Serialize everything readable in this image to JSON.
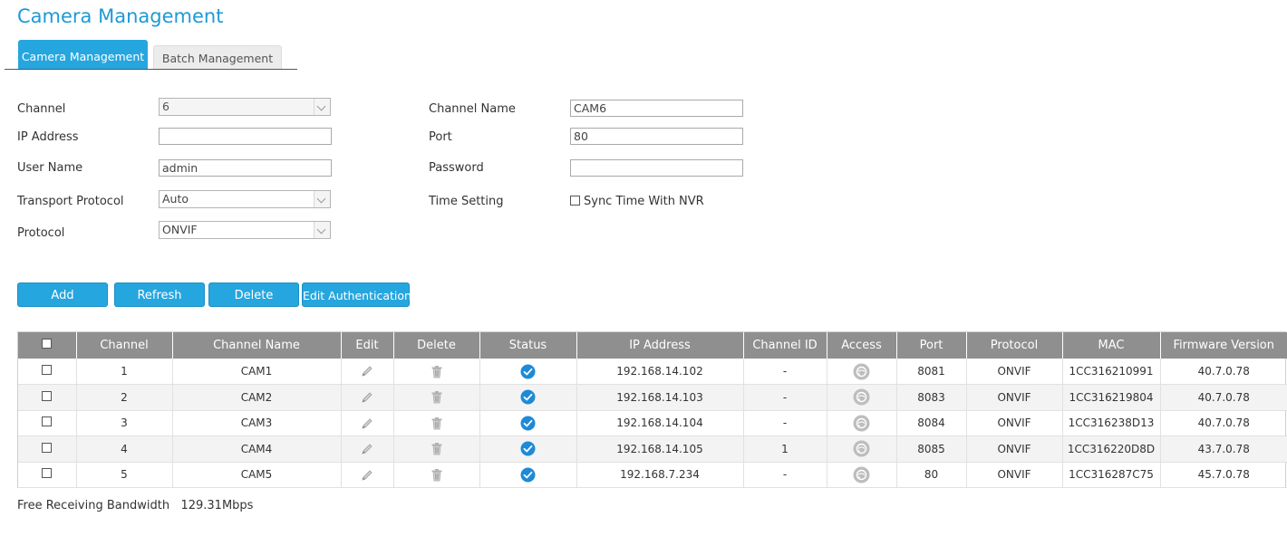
{
  "page": {
    "title": "Camera Management"
  },
  "tabs": [
    {
      "label": "Camera Management",
      "active": true
    },
    {
      "label": "Batch Management",
      "active": false
    }
  ],
  "form": {
    "channel_label": "Channel",
    "channel_value": "6",
    "channel_name_label": "Channel Name",
    "channel_name_value": "CAM6",
    "ip_label": "IP Address",
    "ip_value": "",
    "port_label": "Port",
    "port_value": "80",
    "user_label": "User Name",
    "user_value": "admin",
    "password_label": "Password",
    "password_value": "",
    "transport_label": "Transport Protocol",
    "transport_value": "Auto",
    "time_label": "Time Setting",
    "sync_label": "Sync Time With NVR",
    "sync_checked": false,
    "protocol_label": "Protocol",
    "protocol_value": "ONVIF"
  },
  "buttons": {
    "add": "Add",
    "refresh": "Refresh",
    "delete": "Delete",
    "edit_auth": "Edit Authentication"
  },
  "table": {
    "headers": {
      "channel": "Channel",
      "channel_name": "Channel Name",
      "edit": "Edit",
      "delete": "Delete",
      "status": "Status",
      "ip": "IP Address",
      "channel_id": "Channel ID",
      "access": "Access",
      "port": "Port",
      "protocol": "Protocol",
      "mac": "MAC",
      "firmware": "Firmware Version"
    },
    "rows": [
      {
        "channel": "1",
        "name": "CAM1",
        "ip": "192.168.14.102",
        "channel_id": "-",
        "port": "8081",
        "protocol": "ONVIF",
        "mac": "1CC316210991",
        "firmware": "40.7.0.78"
      },
      {
        "channel": "2",
        "name": "CAM2",
        "ip": "192.168.14.103",
        "channel_id": "-",
        "port": "8083",
        "protocol": "ONVIF",
        "mac": "1CC316219804",
        "firmware": "40.7.0.78"
      },
      {
        "channel": "3",
        "name": "CAM3",
        "ip": "192.168.14.104",
        "channel_id": "-",
        "port": "8084",
        "protocol": "ONVIF",
        "mac": "1CC316238D13",
        "firmware": "40.7.0.78"
      },
      {
        "channel": "4",
        "name": "CAM4",
        "ip": "192.168.14.105",
        "channel_id": "1",
        "port": "8085",
        "protocol": "ONVIF",
        "mac": "1CC316220D8D",
        "firmware": "43.7.0.78"
      },
      {
        "channel": "5",
        "name": "CAM5",
        "ip": "192.168.7.234",
        "channel_id": "-",
        "port": "80",
        "protocol": "ONVIF",
        "mac": "1CC316287C75",
        "firmware": "45.7.0.78"
      }
    ]
  },
  "footer": {
    "bandwidth_label": "Free Receiving Bandwidth",
    "bandwidth_value": "129.31Mbps"
  },
  "icons": {
    "edit": "pencil-icon",
    "delete": "trash-icon",
    "status": "check-circle-icon",
    "access": "globe-icon"
  },
  "colors": {
    "accent": "#26a6df",
    "title": "#1e9ad6",
    "table_header": "#8f8f8f",
    "status_ok": "#1e8ad6"
  }
}
